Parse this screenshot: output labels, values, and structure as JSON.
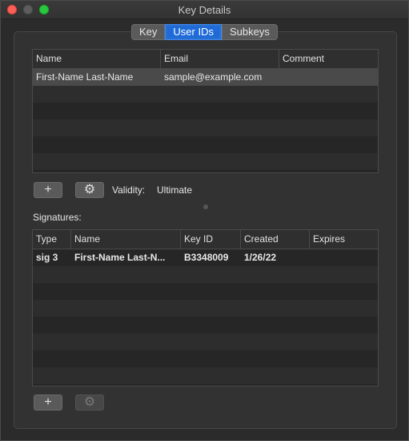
{
  "window": {
    "title": "Key Details"
  },
  "tabs": [
    "Key",
    "User IDs",
    "Subkeys"
  ],
  "user_ids": {
    "columns": [
      "Name",
      "Email",
      "Comment"
    ],
    "rows": [
      {
        "name": "First-Name Last-Name",
        "email": "sample@example.com",
        "comment": ""
      }
    ]
  },
  "user_ids_toolbar": {
    "add": "+",
    "settings": "⚙",
    "validity_label": "Validity:",
    "validity_value": "Ultimate"
  },
  "signatures": {
    "label": "Signatures:",
    "columns": [
      "Type",
      "Name",
      "Key ID",
      "Created",
      "Expires"
    ],
    "rows": [
      {
        "type": "sig 3",
        "name": "First-Name Last-N...",
        "key_id": "B3348009",
        "created": "1/26/22",
        "expires": ""
      }
    ]
  },
  "signatures_toolbar": {
    "add": "+",
    "settings": "⚙"
  }
}
